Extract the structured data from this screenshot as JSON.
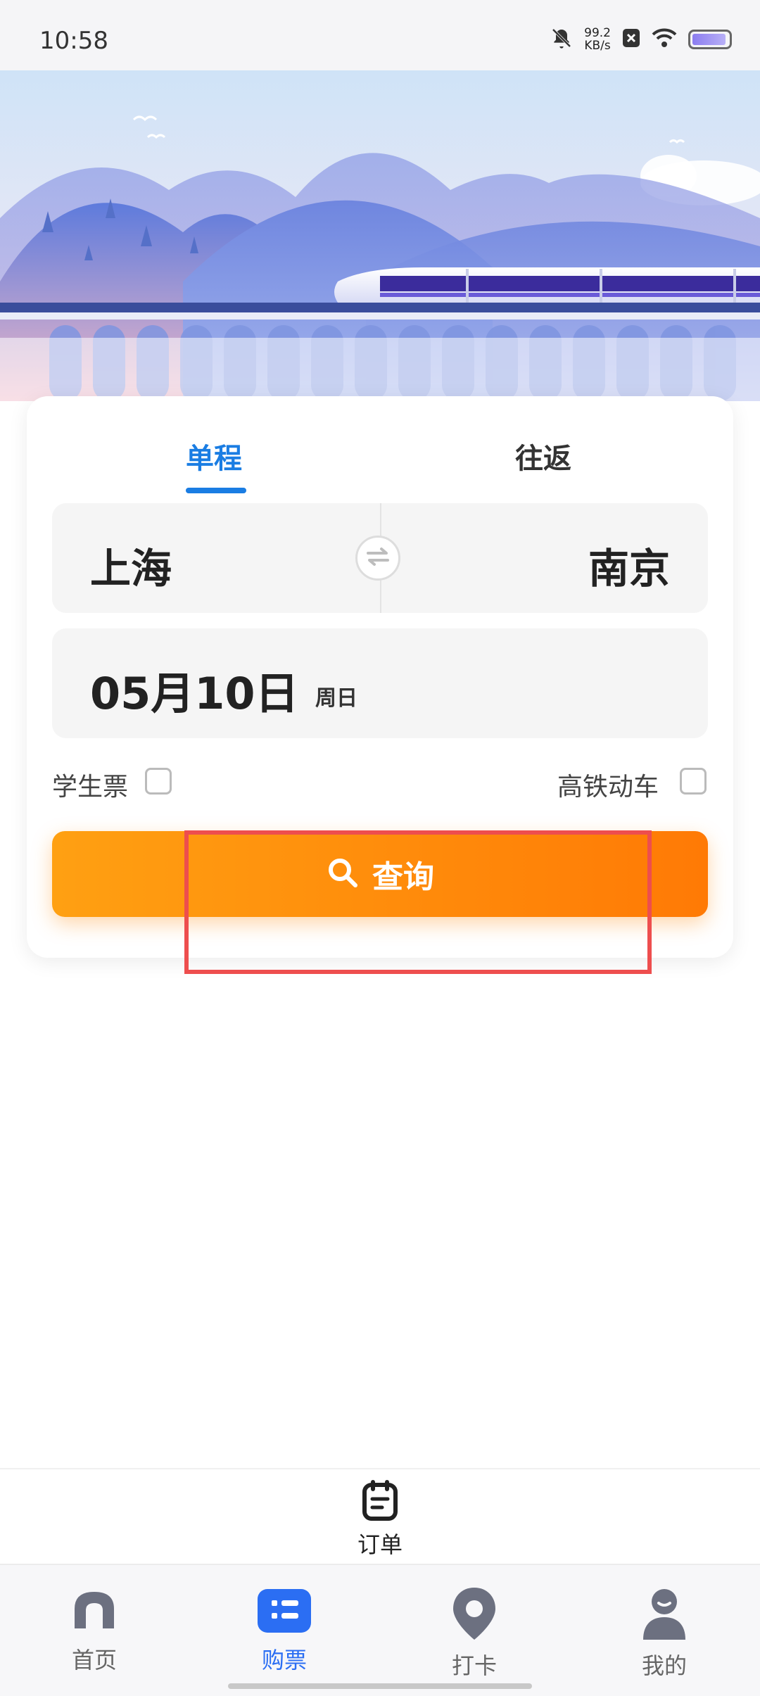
{
  "status_bar": {
    "time": "10:58",
    "speed_value": "99.2",
    "speed_unit": "KB/s"
  },
  "tabs": {
    "oneway": "单程",
    "roundtrip": "往返"
  },
  "route": {
    "from": "上海",
    "to": "南京"
  },
  "date": {
    "date": "05月10日",
    "weekday": "周日"
  },
  "options": {
    "student": "学生票",
    "high_speed": "高铁动车"
  },
  "search": {
    "label": "查询"
  },
  "orders": {
    "label": "订单"
  },
  "nav": {
    "items": [
      {
        "label": "首页"
      },
      {
        "label": "购票"
      },
      {
        "label": "打卡"
      },
      {
        "label": "我的"
      }
    ]
  },
  "colors": {
    "accent": "#1a7de3",
    "search_start": "#ffa012",
    "search_end": "#ff7a05",
    "nav_active": "#2b6ef3",
    "highlight": "#ee4e4e"
  }
}
